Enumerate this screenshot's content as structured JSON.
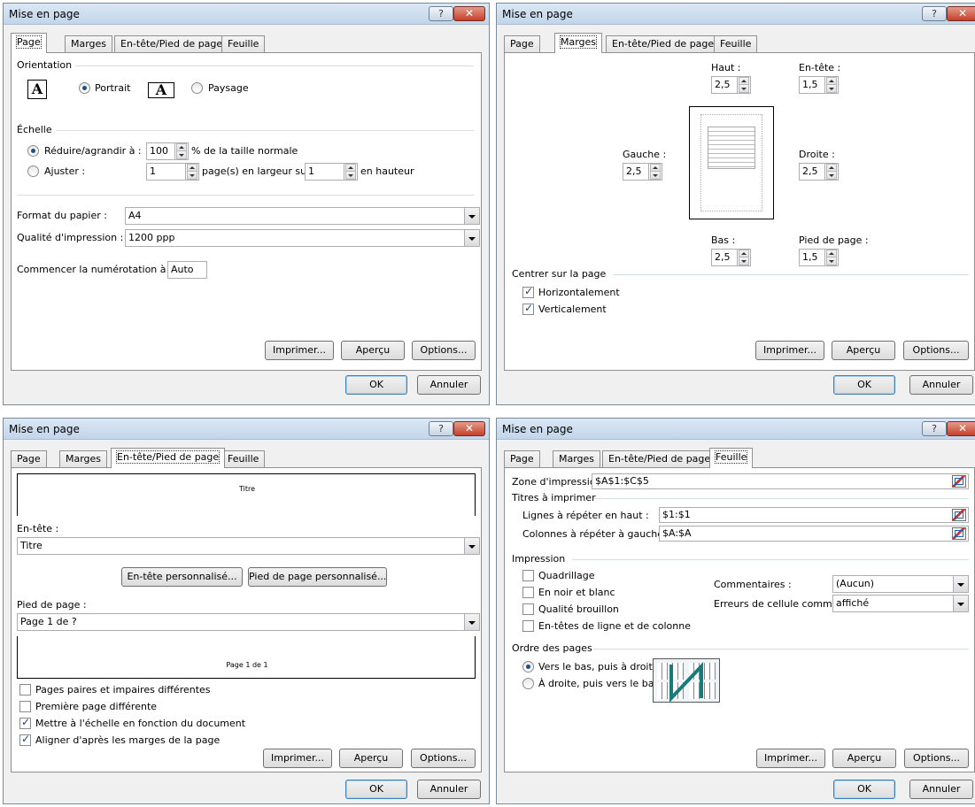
{
  "common": {
    "title": "Mise en page",
    "help": "?",
    "close": "✕",
    "tabs": [
      "Page",
      "Marges",
      "En-tête/Pied de page",
      "Feuille"
    ],
    "btn_print": "Imprimer...",
    "btn_preview": "Aperçu",
    "btn_options": "Options...",
    "btn_ok": "OK",
    "btn_cancel": "Annuler"
  },
  "page_tab": {
    "orientation_label": "Orientation",
    "portrait": "Portrait",
    "paysage": "Paysage",
    "icon_letter": "A",
    "echelle_label": "Échelle",
    "reduire": "Réduire/agrandir à :",
    "reduire_value": "100",
    "pct_text": "% de la taille normale",
    "ajuster": "Ajuster :",
    "ajuster_width": "1",
    "ajuster_mid": "page(s) en largeur sur",
    "ajuster_height": "1",
    "ajuster_end": "en hauteur",
    "format_label": "Format du papier :",
    "format_value": "A4",
    "qualite_label": "Qualité d'impression :",
    "qualite_value": "1200 ppp",
    "numerotation_label": "Commencer la numérotation à :",
    "numerotation_value": "Auto"
  },
  "marges_tab": {
    "haut_label": "Haut :",
    "haut_value": "2,5",
    "entete_label": "En-tête :",
    "entete_value": "1,5",
    "gauche_label": "Gauche :",
    "gauche_value": "2,5",
    "droite_label": "Droite :",
    "droite_value": "2,5",
    "bas_label": "Bas :",
    "bas_value": "2,5",
    "pied_label": "Pied de page :",
    "pied_value": "1,5",
    "centrer_label": "Centrer sur la page",
    "horizontalement": "Horizontalement",
    "verticalement": "Verticalement"
  },
  "entete_tab": {
    "header_preview_text": "Titre",
    "entete_label": "En-tête :",
    "entete_value": "Titre",
    "btn_entete_perso": "En-tête personnalisé...",
    "btn_pied_perso": "Pied de page personnalisé...",
    "pied_label": "Pied de page :",
    "pied_value": "Page 1 de ?",
    "footer_preview_text": "Page 1 de 1",
    "cb_paires": "Pages paires et impaires différentes",
    "cb_premiere": "Première page différente",
    "cb_echelle": "Mettre à l'échelle en fonction du document",
    "cb_aligner": "Aligner d'après les marges de la page"
  },
  "feuille_tab": {
    "zone_label": "Zone d'impression :",
    "zone_value": "$A$1:$C$5",
    "titres_label": "Titres à imprimer",
    "lignes_label": "Lignes à répéter en haut :",
    "lignes_value": "$1:$1",
    "colonnes_label": "Colonnes à répéter à gauche :",
    "colonnes_value": "$A:$A",
    "impression_label": "Impression",
    "cb_quadrillage": "Quadrillage",
    "cb_noir": "En noir et blanc",
    "cb_brouillon": "Qualité brouillon",
    "cb_entetes": "En-têtes de ligne et de colonne",
    "commentaires_label": "Commentaires :",
    "commentaires_value": "(Aucun)",
    "erreurs_label": "Erreurs de cellule comme :",
    "erreurs_value": "affiché",
    "ordre_label": "Ordre des pages",
    "ordre_bas": "Vers le bas, puis à droite",
    "ordre_droite": "À droite, puis vers le bas"
  }
}
